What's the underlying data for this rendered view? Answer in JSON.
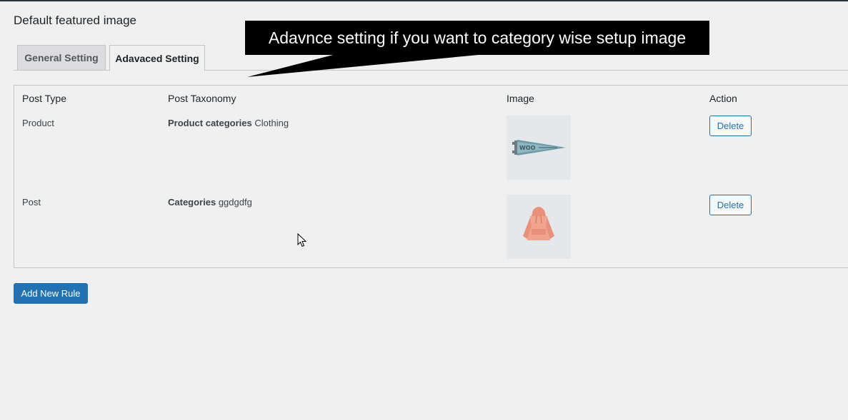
{
  "page": {
    "title": "Default featured image"
  },
  "tabs": [
    {
      "label": "General Setting",
      "active": false
    },
    {
      "label": "Adavaced Setting",
      "active": true
    }
  ],
  "callout": {
    "text": "Adavnce setting if you want to category wise setup image"
  },
  "table": {
    "headers": {
      "post_type": "Post Type",
      "post_taxonomy": "Post Taxonomy",
      "image": "Image",
      "action": "Action"
    },
    "rows": [
      {
        "post_type": "Product",
        "taxonomy_name": "Product categories",
        "term": "Clothing",
        "image_icon": "pennant-image",
        "action_label": "Delete"
      },
      {
        "post_type": "Post",
        "taxonomy_name": "Categories",
        "term": "ggdgdfg",
        "image_icon": "hoodie-image",
        "action_label": "Delete"
      }
    ]
  },
  "add_rule_label": "Add New Rule",
  "colors": {
    "accent": "#2271b1",
    "background": "#f0f0f1",
    "callout_bg": "#000000"
  }
}
